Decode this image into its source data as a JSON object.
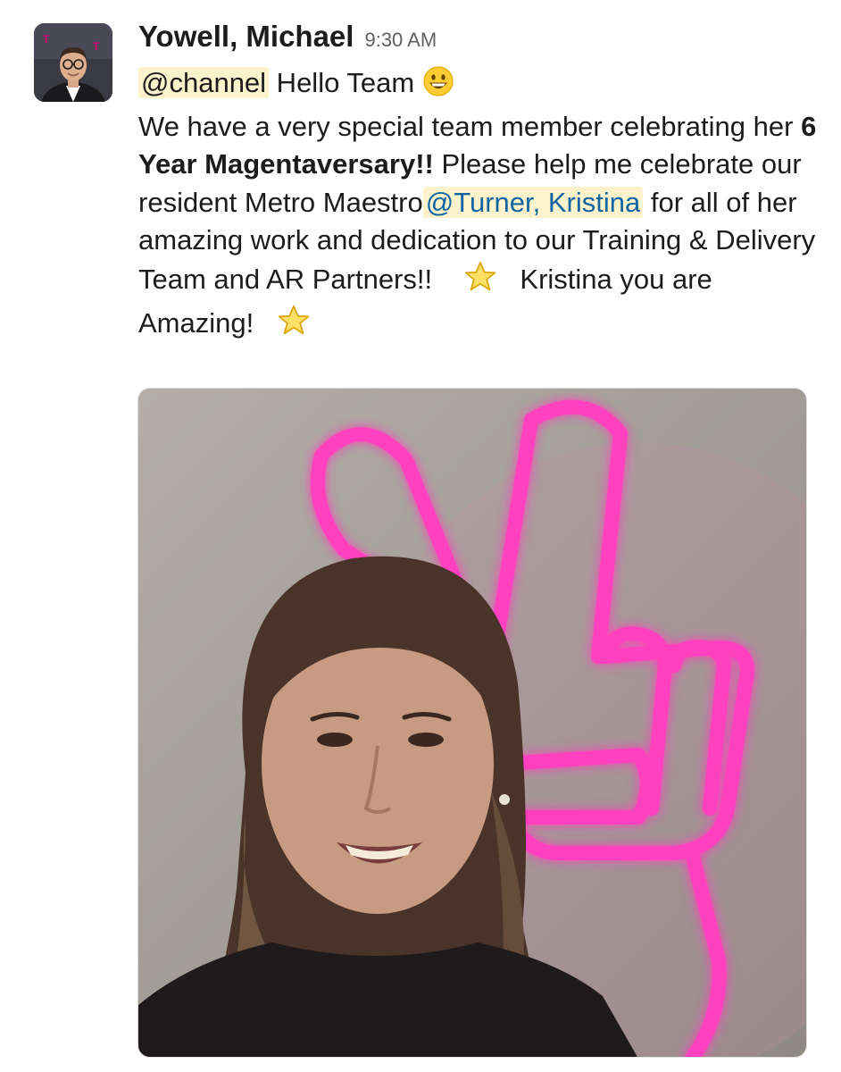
{
  "message": {
    "sender": "Yowell, Michael",
    "timestamp": "9:30 AM",
    "mention_channel": "@channel",
    "greeting": " Hello Team ",
    "line1": " We have a very special team member celebrating her ",
    "bold_text": "6 Year Magentaversary!!",
    "line2": " Please help me celebrate our resident Metro Maestro",
    "mention_user": "@Turner, Kristina",
    "line3": " for all of her amazing work and dedication to our Training & Delivery Team and AR Partners!!",
    "line4": "Kristina you are Amazing!",
    "emojis": [
      "grinning-face",
      "star",
      "star"
    ]
  },
  "colors": {
    "mention_bg": "#fcf3cc",
    "mention_link": "#1264a3",
    "neon_pink": "#ff3fbf",
    "brand_magenta": "#e20074"
  }
}
